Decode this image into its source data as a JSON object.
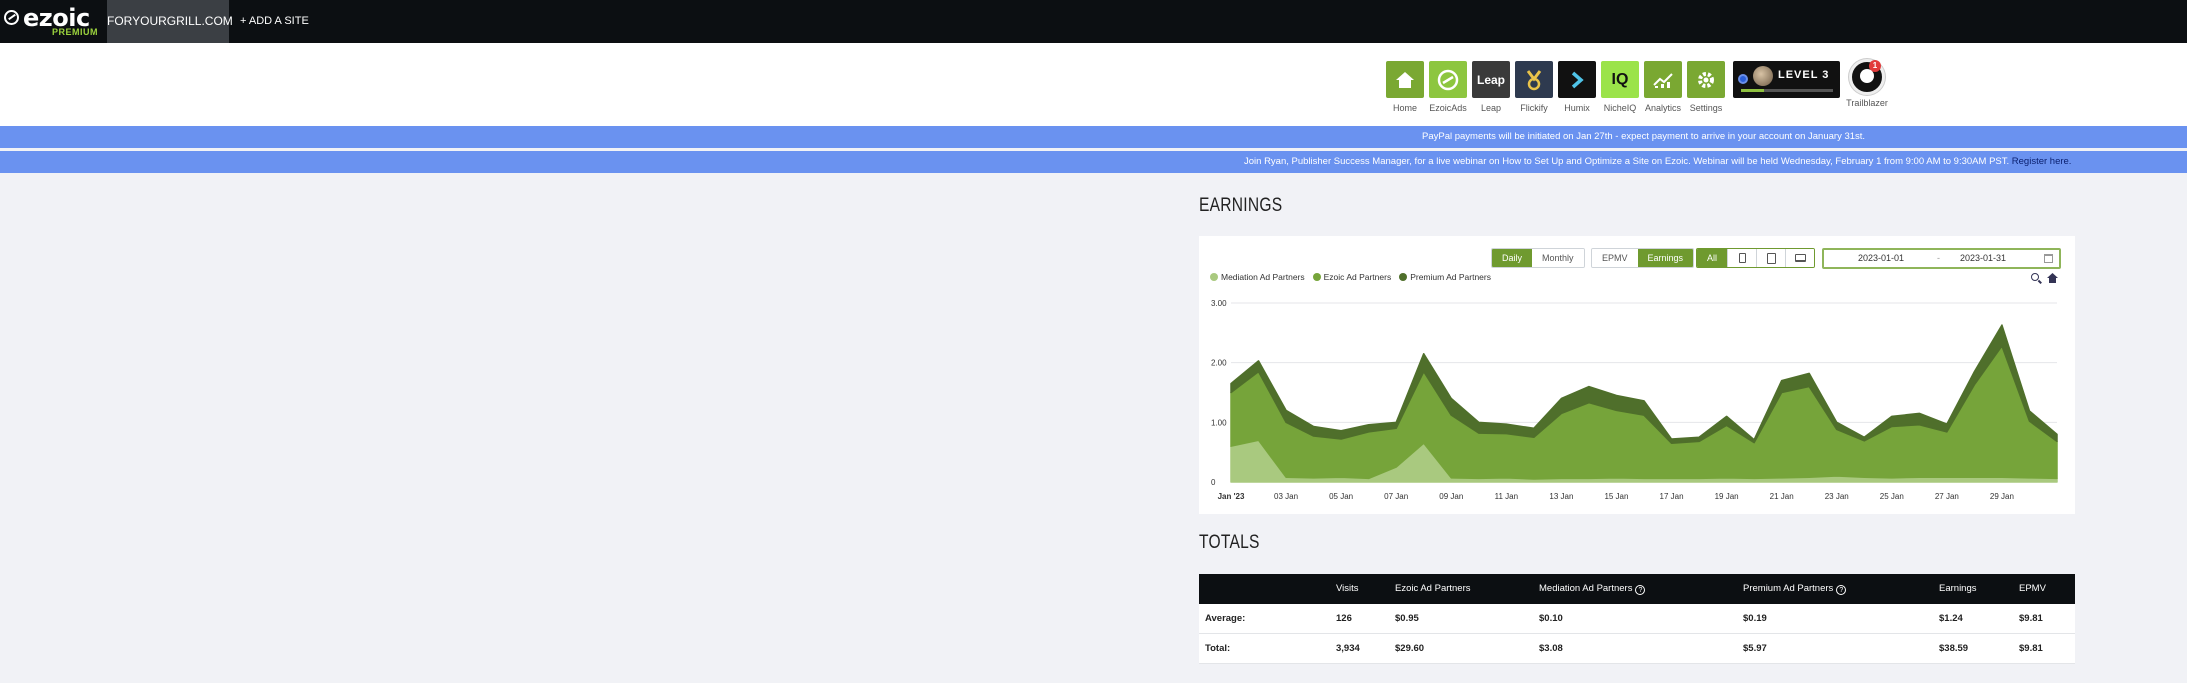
{
  "topbar": {
    "logo_text": "ezoic",
    "logo_tier": "PREMIUM",
    "site_name": "FORYOURGRILL.COM",
    "add_site": "+ ADD A SITE"
  },
  "apps": [
    {
      "label": "Home",
      "icon": "house-icon",
      "color": "#7aa832"
    },
    {
      "label": "EzoicAds",
      "icon": "ezoic-ads-icon",
      "color": "#8dc63f"
    },
    {
      "label": "Leap",
      "icon": "leap-icon",
      "color": "#3a3a3a",
      "tile_text": "Leap"
    },
    {
      "label": "Flickify",
      "icon": "flickify-icon",
      "color": "#2e3a4f"
    },
    {
      "label": "Humix",
      "icon": "humix-icon",
      "color": "#111111"
    },
    {
      "label": "NicheIQ",
      "icon": "nicheiq-icon",
      "color": "#9be34a",
      "tile_text": "IQ"
    },
    {
      "label": "Analytics",
      "icon": "analytics-icon",
      "color": "#7aa832"
    },
    {
      "label": "Settings",
      "icon": "gear-icon",
      "color": "#7aa832"
    }
  ],
  "level": {
    "text": "LEVEL 3",
    "progress": 0.25
  },
  "trailblazer": {
    "label": "Trailblazer",
    "notifications": "1"
  },
  "banners": {
    "paypal": "PayPal payments will be initiated on Jan 27th - expect payment to arrive in your account on January 31st.",
    "webinar": "Join Ryan, Publisher Success Manager, for a live webinar on How to Set Up and Optimize a Site on Ezoic. Webinar will be held Wednesday, February 1 from 9:00 AM to 9:30AM PST.",
    "webinar_link": "Register here."
  },
  "earnings": {
    "title": "EARNINGS",
    "period_buttons": [
      "Daily",
      "Monthly"
    ],
    "metric_buttons": [
      "EPMV",
      "Earnings"
    ],
    "device_all": "All",
    "date_start": "2023-01-01",
    "date_sep": "-",
    "date_end": "2023-01-31"
  },
  "chart_data": {
    "type": "area",
    "stacked": true,
    "x": [
      "2023-01-01",
      "2023-01-02",
      "2023-01-03",
      "2023-01-04",
      "2023-01-05",
      "2023-01-06",
      "2023-01-07",
      "2023-01-08",
      "2023-01-09",
      "2023-01-10",
      "2023-01-11",
      "2023-01-12",
      "2023-01-13",
      "2023-01-14",
      "2023-01-15",
      "2023-01-16",
      "2023-01-17",
      "2023-01-18",
      "2023-01-19",
      "2023-01-20",
      "2023-01-21",
      "2023-01-22",
      "2023-01-23",
      "2023-01-24",
      "2023-01-25",
      "2023-01-26",
      "2023-01-27",
      "2023-01-28",
      "2023-01-29",
      "2023-01-30",
      "2023-01-31"
    ],
    "x_tick_labels": [
      "Jan '23",
      "03 Jan",
      "05 Jan",
      "07 Jan",
      "09 Jan",
      "11 Jan",
      "13 Jan",
      "15 Jan",
      "17 Jan",
      "19 Jan",
      "21 Jan",
      "23 Jan",
      "25 Jan",
      "27 Jan",
      "29 Jan"
    ],
    "y_tick_labels": [
      "3.00",
      "2.00",
      "1.00",
      "0"
    ],
    "ylim": [
      0,
      3
    ],
    "grid": true,
    "legend_position": "top-left",
    "series": [
      {
        "name": "Mediation Ad Partners",
        "color": "#a9c97f",
        "values": [
          0.6,
          0.7,
          0.08,
          0.07,
          0.08,
          0.06,
          0.25,
          0.65,
          0.07,
          0.06,
          0.07,
          0.05,
          0.06,
          0.06,
          0.07,
          0.06,
          0.06,
          0.06,
          0.07,
          0.06,
          0.07,
          0.08,
          0.1,
          0.08,
          0.07,
          0.08,
          0.08,
          0.08,
          0.08,
          0.07,
          0.06
        ]
      },
      {
        "name": "Ezoic Ad Partners",
        "color": "#76a43a",
        "values": [
          0.9,
          1.15,
          0.92,
          0.7,
          0.64,
          0.78,
          0.65,
          1.2,
          1.05,
          0.76,
          0.74,
          0.7,
          1.09,
          1.27,
          1.13,
          1.06,
          0.59,
          0.62,
          0.88,
          0.6,
          1.43,
          1.52,
          0.78,
          0.61,
          0.86,
          0.88,
          0.76,
          1.55,
          2.2,
          0.95,
          0.62
        ]
      },
      {
        "name": "Premium Ad Partners",
        "color": "#4f6f2b",
        "values": [
          0.15,
          0.18,
          0.2,
          0.16,
          0.14,
          0.12,
          0.1,
          0.3,
          0.28,
          0.18,
          0.16,
          0.15,
          0.25,
          0.27,
          0.25,
          0.24,
          0.07,
          0.07,
          0.15,
          0.05,
          0.2,
          0.22,
          0.12,
          0.06,
          0.17,
          0.19,
          0.13,
          0.22,
          0.35,
          0.17,
          0.12
        ]
      }
    ]
  },
  "totals": {
    "title": "TOTALS",
    "columns": [
      "",
      "Visits",
      "Ezoic Ad Partners",
      "Mediation Ad Partners",
      "Premium Ad Partners",
      "Earnings",
      "EPMV"
    ],
    "help_mark": "?",
    "rows": [
      {
        "label": "Average:",
        "visits": "126",
        "ezoic": "$0.95",
        "mediation": "$0.10",
        "premium": "$0.19",
        "earnings": "$1.24",
        "epmv": "$9.81"
      },
      {
        "label": "Total:",
        "visits": "3,934",
        "ezoic": "$29.60",
        "mediation": "$3.08",
        "premium": "$5.97",
        "earnings": "$38.59",
        "epmv": "$9.81"
      }
    ]
  }
}
